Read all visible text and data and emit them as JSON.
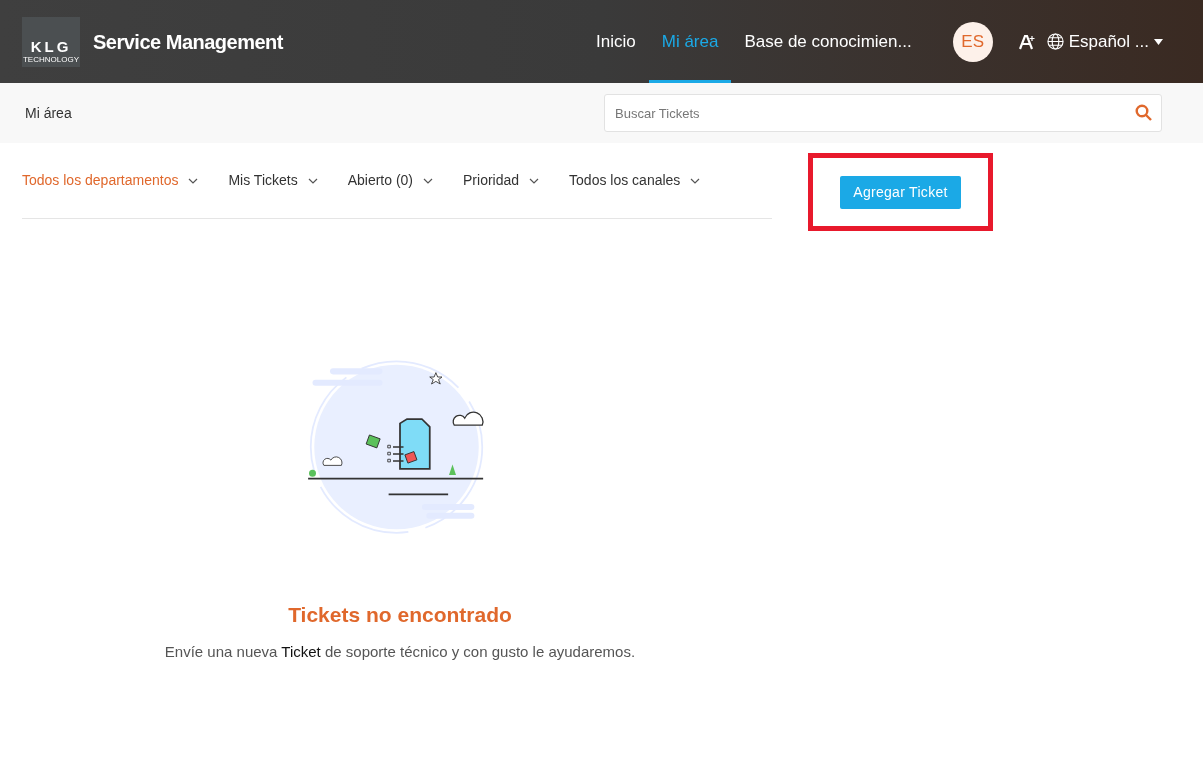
{
  "header": {
    "logo": {
      "mark": "KLG",
      "subtitle": "TECHNOLOGY"
    },
    "title": "Service Management",
    "nav": [
      {
        "label": "Inicio",
        "selected": false
      },
      {
        "label": "Mi área",
        "selected": true
      },
      {
        "label": "Base de conocimien...",
        "selected": false
      }
    ],
    "avatar": "ES",
    "language": "Español ..."
  },
  "breadcrumb": "Mi área",
  "search": {
    "placeholder": "Buscar Tickets"
  },
  "filters": [
    {
      "label": "Todos los departamentos",
      "selected": true
    },
    {
      "label": "Mis Tickets",
      "selected": false
    },
    {
      "label": "Abierto (0)",
      "selected": false
    },
    {
      "label": "Prioridad",
      "selected": false
    },
    {
      "label": "Todos los canales",
      "selected": false
    }
  ],
  "add_button": "Agregar Ticket",
  "empty": {
    "title": "Tickets no encontrado",
    "message": "Envíe una nueva **Ticket** de soporte técnico y con gusto le ayudaremos."
  }
}
